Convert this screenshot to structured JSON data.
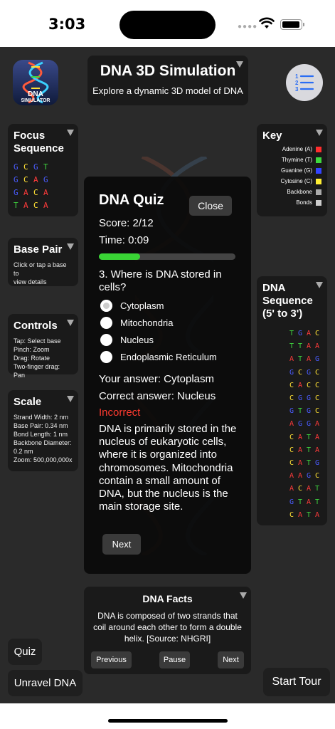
{
  "status": {
    "time": "3:03"
  },
  "header": {
    "title": "DNA 3D Simulation",
    "subtitle": "Explore a dynamic 3D model of DNA",
    "app_icon_text": [
      "DNA",
      "SIMULATOR"
    ]
  },
  "focus": {
    "title": [
      "Focus",
      "Sequence"
    ],
    "rows": [
      [
        "G",
        "C",
        "G",
        "T"
      ],
      [
        "G",
        "C",
        "A",
        "G"
      ],
      [
        "G",
        "A",
        "C",
        "A"
      ],
      [
        "T",
        "A",
        "C",
        "A"
      ]
    ]
  },
  "base_pair": {
    "title": "Base Pair",
    "hint": [
      "Click or tap a base to",
      "view details"
    ]
  },
  "controls": {
    "title": "Controls",
    "lines": [
      "Tap: Select base",
      "Pinch: Zoom",
      "Drag: Rotate",
      "Two-finger drag: Pan"
    ]
  },
  "scale": {
    "title": "Scale",
    "lines": [
      "Strand Width: 2 nm",
      "Base Pair: 0.34 nm",
      "Bond Length: 1 nm",
      "Backbone Diameter:",
      "0.2 nm",
      "Zoom: 500,000,000x"
    ]
  },
  "key": {
    "title": "Key",
    "items": [
      {
        "label": "Adenine (A)",
        "color": "#ff2d2d"
      },
      {
        "label": "Thymine (T)",
        "color": "#3ed83e"
      },
      {
        "label": "Guanine (G)",
        "color": "#3344ff"
      },
      {
        "label": "Cytosine (C)",
        "color": "#ffee33"
      },
      {
        "label": "Backbone",
        "color": "#aaaaaa"
      },
      {
        "label": "Bonds",
        "color": "#cccccc"
      }
    ]
  },
  "sequence": {
    "title": [
      "DNA",
      "Sequence",
      "(5' to 3')"
    ],
    "rows": [
      [
        "T",
        "G",
        "A",
        "C"
      ],
      [
        "T",
        "T",
        "A",
        "A"
      ],
      [
        "A",
        "T",
        "A",
        "G"
      ],
      [
        "G",
        "C",
        "G",
        "C"
      ],
      [
        "C",
        "A",
        "C",
        "C"
      ],
      [
        "C",
        "G",
        "G",
        "C"
      ],
      [
        "G",
        "T",
        "G",
        "C"
      ],
      [
        "A",
        "G",
        "G",
        "A"
      ],
      [
        "C",
        "A",
        "T",
        "A"
      ],
      [
        "C",
        "A",
        "T",
        "A"
      ],
      [
        "C",
        "A",
        "T",
        "G"
      ],
      [
        "A",
        "A",
        "G",
        "C"
      ],
      [
        "A",
        "C",
        "A",
        "T"
      ],
      [
        "G",
        "T",
        "A",
        "T"
      ],
      [
        "C",
        "A",
        "T",
        "A"
      ]
    ]
  },
  "base_colors": {
    "A": "#ff3b3b",
    "T": "#3fd23f",
    "G": "#4a5cff",
    "C": "#ffe135"
  },
  "quiz": {
    "title": "DNA Quiz",
    "close_label": "Close",
    "score": "Score: 2/12",
    "time": "Time: 0:09",
    "progress": 0.3,
    "question": "3. Where is DNA stored in cells?",
    "options": [
      "Cytoplasm",
      "Mitochondria",
      "Nucleus",
      "Endoplasmic Reticulum"
    ],
    "selected_index": 0,
    "your_answer": "Your answer: Cytoplasm",
    "correct_answer": "Correct answer: Nucleus",
    "result": "Incorrect",
    "result_color": "#ff3b30",
    "explanation": "DNA is primarily stored in the nucleus of eukaryotic cells, where it is organized into chromosomes. Mitochondria contain a small amount of DNA, but the nucleus is the main storage site.",
    "next_label": "Next"
  },
  "facts": {
    "title": "DNA Facts",
    "text": "DNA is composed of two strands that coil around each other to form a double helix. [Source: NHGRI]",
    "prev_label": "Previous",
    "pause_label": "Pause",
    "next_label": "Next"
  },
  "buttons": {
    "quiz": "Quiz",
    "unravel": "Unravel DNA",
    "tour": "Start Tour"
  },
  "icons": {
    "menu": "list-icon",
    "wifi": "wifi-icon",
    "battery": "battery-icon"
  }
}
